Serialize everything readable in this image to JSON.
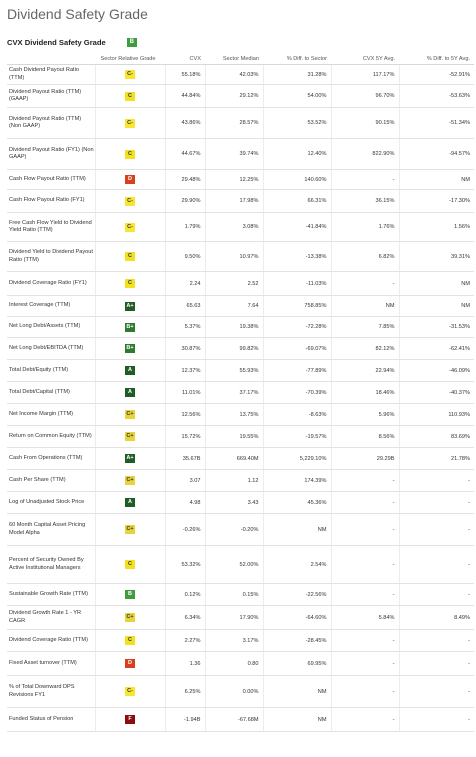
{
  "title": "Dividend Safety Grade",
  "subtitle": "CVX Dividend Safety Grade",
  "overall_grade": "B",
  "headers": [
    "",
    "Sector Relative Grade",
    "CVX",
    "Sector Median",
    "% Diff. to Sector",
    "CVX 5Y Avg.",
    "% Diff. to 5Y Avg."
  ],
  "rows": [
    {
      "metric": "Cash Dividend Payout Ratio (TTM)",
      "grade": "C-",
      "cvx": "55.18%",
      "median": "42.03%",
      "diff_sector": "31.28%",
      "avg5y": "117.17%",
      "diff_5y": "-52.91%",
      "h": 20
    },
    {
      "metric": "Dividend Payout Ratio (TTM) (GAAP)",
      "grade": "C",
      "cvx": "44.84%",
      "median": "29.12%",
      "diff_sector": "54.00%",
      "avg5y": "96.70%",
      "diff_5y": "-53.63%",
      "h": 23
    },
    {
      "metric": "Dividend Payout Ratio (TTM) (Non GAAP)",
      "grade": "C-",
      "cvx": "43.86%",
      "median": "28.57%",
      "diff_sector": "53.52%",
      "avg5y": "90.15%",
      "diff_5y": "-51.34%",
      "h": 31
    },
    {
      "metric": "Dividend Payout Ratio (FY1) (Non GAAP)",
      "grade": "C",
      "cvx": "44.67%",
      "median": "39.74%",
      "diff_sector": "12.40%",
      "avg5y": "822.90%",
      "diff_5y": "-94.57%",
      "h": 31
    },
    {
      "metric": "Cash Flow Payout Ratio (TTM)",
      "grade": "D",
      "cvx": "29.48%",
      "median": "12.25%",
      "diff_sector": "140.60%",
      "avg5y": "-",
      "diff_5y": "NM",
      "h": 20
    },
    {
      "metric": "Cash Flow Payout Ratio (FY1)",
      "grade": "C-",
      "cvx": "29.90%",
      "median": "17.98%",
      "diff_sector": "66.31%",
      "avg5y": "36.15%",
      "diff_5y": "-17.30%",
      "h": 23
    },
    {
      "metric": "Free Cash Flow Yield to Dividend Yield Ratio (TTM)",
      "grade": "C-",
      "cvx": "1.79%",
      "median": "3.08%",
      "diff_sector": "-41.84%",
      "avg5y": "1.76%",
      "diff_5y": "1.56%",
      "h": 29
    },
    {
      "metric": "Dividend Yield to Dividend Payout Ratio (TTM)",
      "grade": "C",
      "cvx": "9.50%",
      "median": "10.97%",
      "diff_sector": "-13.38%",
      "avg5y": "6.82%",
      "diff_5y": "39.31%",
      "h": 30
    },
    {
      "metric": "Dividend Coverage Ratio (FY1)",
      "grade": "C",
      "cvx": "2.24",
      "median": "2.52",
      "diff_sector": "-11.03%",
      "avg5y": "-",
      "diff_5y": "NM",
      "h": 24
    },
    {
      "metric": "Interest Coverage (TTM)",
      "grade": "A+",
      "cvx": "65.63",
      "median": "7.64",
      "diff_sector": "758.85%",
      "avg5y": "NM",
      "diff_5y": "NM",
      "h": 21
    },
    {
      "metric": "Net Long Debt/Assets (TTM)",
      "grade": "B+",
      "cvx": "5.37%",
      "median": "19.38%",
      "diff_sector": "-72.28%",
      "avg5y": "7.85%",
      "diff_5y": "-31.53%",
      "h": 21
    },
    {
      "metric": "Net Long Debt/EBITDA (TTM)",
      "grade": "B+",
      "cvx": "30.87%",
      "median": "99.82%",
      "diff_sector": "-69.07%",
      "avg5y": "82.12%",
      "diff_5y": "-62.41%",
      "h": 22
    },
    {
      "metric": "Total Debt/Equity (TTM)",
      "grade": "A",
      "cvx": "12.37%",
      "median": "55.93%",
      "diff_sector": "-77.89%",
      "avg5y": "22.94%",
      "diff_5y": "-46.09%",
      "h": 22
    },
    {
      "metric": "Total Debt/Capital (TTM)",
      "grade": "A",
      "cvx": "11.01%",
      "median": "37.17%",
      "diff_sector": "-70.39%",
      "avg5y": "18.46%",
      "diff_5y": "-40.37%",
      "h": 22
    },
    {
      "metric": "Net Income Margin (TTM)",
      "grade": "C+",
      "cvx": "12.56%",
      "median": "13.75%",
      "diff_sector": "-8.63%",
      "avg5y": "5.96%",
      "diff_5y": "110.93%",
      "h": 22
    },
    {
      "metric": "Return on Common Equity (TTM)",
      "grade": "C+",
      "cvx": "15.72%",
      "median": "19.55%",
      "diff_sector": "-19.57%",
      "avg5y": "8.56%",
      "diff_5y": "83.69%",
      "h": 22
    },
    {
      "metric": "Cash From Operations (TTM)",
      "grade": "A+",
      "cvx": "35.67B",
      "median": "669.40M",
      "diff_sector": "5,229.10%",
      "avg5y": "29.29B",
      "diff_5y": "21.78%",
      "h": 22
    },
    {
      "metric": "Cash Per Share (TTM)",
      "grade": "C+",
      "cvx": "3.07",
      "median": "1.12",
      "diff_sector": "174.39%",
      "avg5y": "-",
      "diff_5y": "-",
      "h": 22
    },
    {
      "metric": "Log of Unadjusted Stock Price",
      "grade": "A",
      "cvx": "4.98",
      "median": "3.43",
      "diff_sector": "45.36%",
      "avg5y": "-",
      "diff_5y": "-",
      "h": 22
    },
    {
      "metric": "60 Month Capital Asset Pricing Model Alpha",
      "grade": "C+",
      "cvx": "-0.26%",
      "median": "-0.20%",
      "diff_sector": "NM",
      "avg5y": "-",
      "diff_5y": "-",
      "h": 32
    },
    {
      "metric": "Percent of Security Owned By Active Institutional Managers",
      "grade": "C",
      "cvx": "53.32%",
      "median": "52.00%",
      "diff_sector": "2.54%",
      "avg5y": "-",
      "diff_5y": "-",
      "h": 38
    },
    {
      "metric": "Sustainable Growth Rate (TTM)",
      "grade": "B",
      "cvx": "0.12%",
      "median": "0.15%",
      "diff_sector": "-22.56%",
      "avg5y": "-",
      "diff_5y": "-",
      "h": 22
    },
    {
      "metric": "Dividend Growth Rate 1 - YR CAGR",
      "grade": "C+",
      "cvx": "6.34%",
      "median": "17.90%",
      "diff_sector": "-64.60%",
      "avg5y": "5.84%",
      "diff_5y": "8.49%",
      "h": 24
    },
    {
      "metric": "Dividend Coverage Ratio (TTM)",
      "grade": "C",
      "cvx": "2.27%",
      "median": "3.17%",
      "diff_sector": "-28.45%",
      "avg5y": "-",
      "diff_5y": "-",
      "h": 22
    },
    {
      "metric": "Fixed Asset turnover (TTM)",
      "grade": "D",
      "cvx": "1.36",
      "median": "0.80",
      "diff_sector": "69.95%",
      "avg5y": "-",
      "diff_5y": "-",
      "h": 24
    },
    {
      "metric": "% of Total Downward DPS Revisions FY1",
      "grade": "C-",
      "cvx": "6.25%",
      "median": "0.00%",
      "diff_sector": "NM",
      "avg5y": "-",
      "diff_5y": "-",
      "h": 32
    },
    {
      "metric": "Funded Status of Pension",
      "grade": "F",
      "cvx": "-1.94B",
      "median": "-67.68M",
      "diff_sector": "NM",
      "avg5y": "-",
      "diff_5y": "-",
      "h": 24
    }
  ]
}
